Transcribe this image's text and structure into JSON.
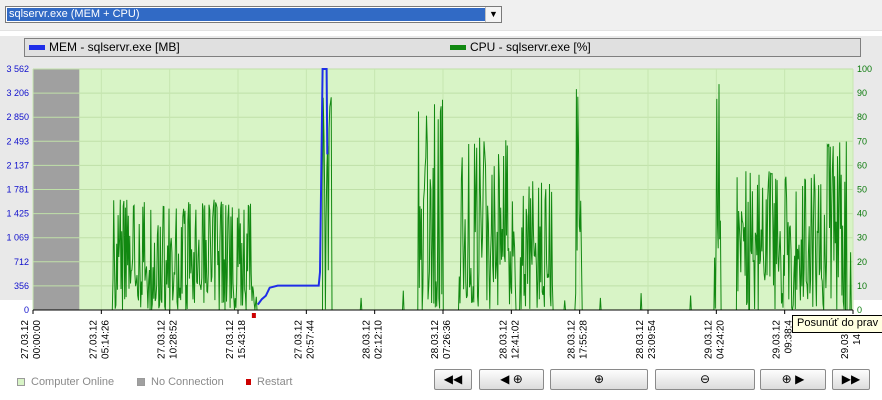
{
  "selector": {
    "value": "sqlservr.exe (MEM + CPU)"
  },
  "legend": {
    "mem_label": "MEM - sqlservr.exe [MB]",
    "cpu_label": "CPU - sqlservr.exe [%]"
  },
  "colors": {
    "mem": "#1f2ee8",
    "cpu": "#118811",
    "online_bg": "#d8f4c6",
    "no_connection_bg": "#a0a0a0",
    "restart": "#cc0000",
    "left_axis": "#1010cc",
    "right_axis": "#0a7a0a"
  },
  "chart_data": {
    "type": "line",
    "x": [
      "27.03.12 00:00:00",
      "27.03.12 05:14:26",
      "27.03.12 10:28:52",
      "27.03.12 15:43:18",
      "27.03.12 20:57:44",
      "28.03.12 02:12:10",
      "28.03.12 07:26:36",
      "28.03.12 12:41:02",
      "28.03.12 17:55:28",
      "28.03.12 23:09:54",
      "29.03.12 04:24:20",
      "29.03.12 09:38:4",
      "29.03.12 14:53"
    ],
    "x_tick_labels": [
      {
        "date": "27.03.12",
        "time": "00:00:00"
      },
      {
        "date": "27.03.12",
        "time": "05:14:26"
      },
      {
        "date": "27.03.12",
        "time": "10:28:52"
      },
      {
        "date": "27.03.12",
        "time": "15:43:18"
      },
      {
        "date": "27.03.12",
        "time": "20:57:44"
      },
      {
        "date": "28.03.12",
        "time": "02:12:10"
      },
      {
        "date": "28.03.12",
        "time": "07:26:36"
      },
      {
        "date": "28.03.12",
        "time": "12:41:02"
      },
      {
        "date": "28.03.12",
        "time": "17:55:28"
      },
      {
        "date": "28.03.12",
        "time": "23:09:54"
      },
      {
        "date": "29.03.12",
        "time": "04:24:20"
      },
      {
        "date": "29.03.12",
        "time": "09:38:4"
      },
      {
        "date": "29.03.12",
        "time": "14:53"
      }
    ],
    "y_left": {
      "label": "MEM - sqlservr.exe [MB]",
      "ticks": [
        "0",
        "356",
        "712",
        "1 069",
        "1 425",
        "1 781",
        "2 137",
        "2 493",
        "2 850",
        "3 206",
        "3 562"
      ],
      "ylim": [
        0,
        3562
      ]
    },
    "y_right": {
      "label": "CPU - sqlservr.exe [%]",
      "ticks": [
        "0",
        "10",
        "20",
        "30",
        "40",
        "50",
        "60",
        "70",
        "80",
        "90",
        "100"
      ],
      "ylim": [
        0,
        100
      ]
    },
    "time_span": [
      0,
      62
    ],
    "no_connection_until": 3.5,
    "grid": true,
    "series": [
      {
        "name": "MEM - sqlservr.exe [MB]",
        "axis": "left",
        "x": [
          17.0,
          17.3,
          17.6,
          17.9,
          18.5,
          21.6,
          21.7,
          21.9,
          22.2,
          22.25
        ],
        "y": [
          80,
          160,
          210,
          330,
          360,
          360,
          560,
          3562,
          3562,
          2300
        ]
      },
      {
        "name": "CPU - sqlservr.exe [%]",
        "axis": "right",
        "active_windows": [
          [
            6.0,
            16.9,
            46
          ],
          [
            21.9,
            22.6,
            92
          ],
          [
            29.1,
            31.0,
            88
          ],
          [
            32.2,
            36.5,
            72
          ],
          [
            36.8,
            39.3,
            55
          ],
          [
            41.0,
            41.5,
            98
          ],
          [
            51.5,
            52.0,
            95
          ],
          [
            53.2,
            54.1,
            58
          ],
          [
            54.2,
            58.5,
            58
          ],
          [
            58.5,
            61.5,
            70
          ]
        ],
        "blips": [
          [
            7.9,
            6
          ],
          [
            24.8,
            5
          ],
          [
            28.0,
            8
          ],
          [
            40.2,
            4
          ],
          [
            42.9,
            5
          ],
          [
            46.0,
            7
          ],
          [
            49.7,
            6
          ],
          [
            61.8,
            24
          ]
        ]
      }
    ],
    "restart_markers": [
      16.7
    ]
  },
  "bottom_legend": {
    "online": "Computer Online",
    "no_connection": "No Connection",
    "restart": "Restart"
  },
  "nav": {
    "first_glyph": "◀◀",
    "prev_glyph": "◀",
    "zoom_in_glyph": "⊕",
    "zoom_out_glyph": "⊖",
    "next_glyph": "▶",
    "last_glyph": "▶▶"
  },
  "tooltip": {
    "text": "Posunúť do prav"
  }
}
